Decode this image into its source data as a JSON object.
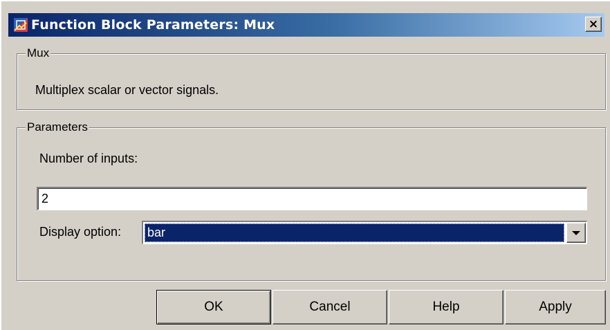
{
  "window": {
    "title": "Function Block Parameters: Mux",
    "close_label": "×"
  },
  "block_group": {
    "legend": "Mux",
    "description": "Multiplex scalar or vector signals."
  },
  "parameters_group": {
    "legend": "Parameters",
    "num_inputs_label": "Number of inputs:",
    "num_inputs_value": "2",
    "display_option_label": "Display option:",
    "display_option_value": "bar"
  },
  "buttons": {
    "ok": "OK",
    "cancel": "Cancel",
    "help": "Help",
    "apply": "Apply"
  },
  "icons": {
    "app": "simulink-block-icon",
    "dropdown": "chevron-down-icon",
    "close": "close-icon"
  }
}
